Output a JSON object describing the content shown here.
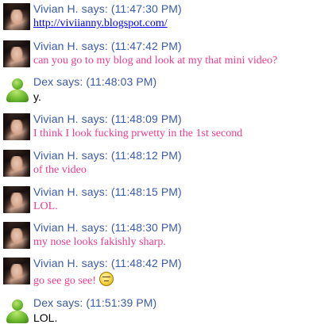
{
  "messages": [
    {
      "sender": "Vivian H.",
      "header": "Vivian H. says: (11:47:30 PM)",
      "text": "http://viviianny.blogspot.com/",
      "style": "link",
      "avatar": "photo"
    },
    {
      "sender": "Vivian H.",
      "header": "Vivian H. says: (11:47:42 PM)",
      "text": "can you go to my blog and look at my that mini video?",
      "style": "pink",
      "avatar": "photo"
    },
    {
      "sender": "Dex",
      "header": "Dex says: (11:48:03 PM)",
      "text": "y.",
      "style": "plain",
      "avatar": "buddy"
    },
    {
      "sender": "Vivian H.",
      "header": "Vivian H. says: (11:48:09 PM)",
      "text": "I think I look fucking prwetty in the 1st second",
      "style": "pink",
      "avatar": "photo"
    },
    {
      "sender": "Vivian H.",
      "header": "Vivian H. says: (11:48:12 PM)",
      "text": "of the video",
      "style": "pink",
      "avatar": "photo"
    },
    {
      "sender": "Vivian H.",
      "header": "Vivian H. says: (11:48:15 PM)",
      "text": "LOL.",
      "style": "pink",
      "avatar": "photo"
    },
    {
      "sender": "Vivian H.",
      "header": "Vivian H. says: (11:48:30 PM)",
      "text": "my nose looks fakishly sharp.",
      "style": "pink",
      "avatar": "photo"
    },
    {
      "sender": "Vivian H.",
      "header": "Vivian H. says: (11:48:42 PM)",
      "text": "go see go see!",
      "style": "pink",
      "avatar": "photo",
      "emoticon": "thinking-emoticon"
    },
    {
      "sender": "Dex",
      "header": "Dex says: (11:51:39 PM)",
      "text": "LOL.",
      "style": "plain",
      "avatar": "buddy"
    }
  ],
  "colors": {
    "header": "#3a5ba8",
    "pink_text": "#ee3a8c",
    "link": "#0000ee",
    "plain_text": "#000000"
  }
}
